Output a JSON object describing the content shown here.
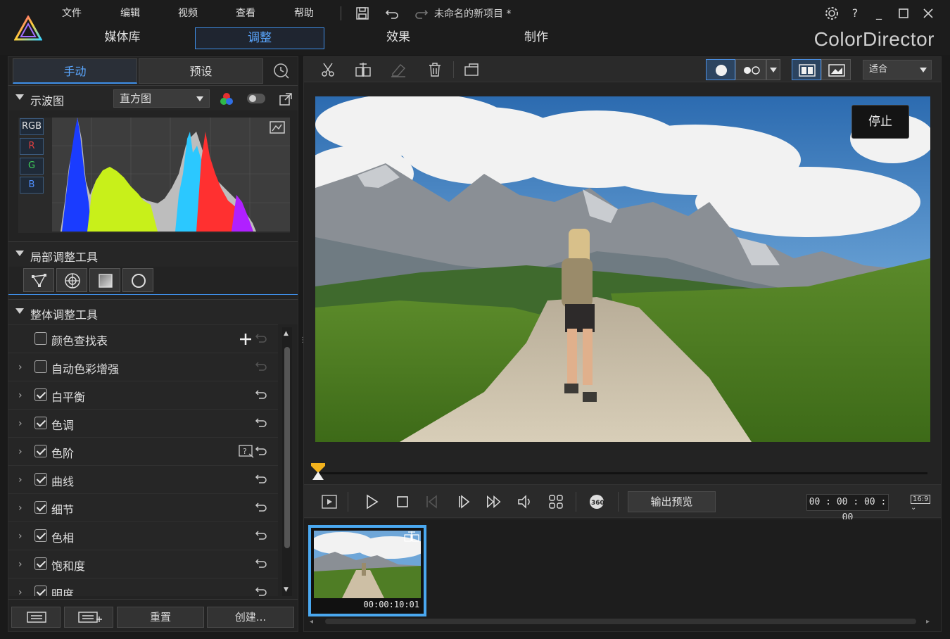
{
  "app": {
    "name": "ColorDirector",
    "project_title": "未命名的新项目 *"
  },
  "menu": [
    "文件",
    "编辑",
    "视频",
    "查看",
    "帮助"
  ],
  "main_tabs": [
    "媒体库",
    "调整",
    "效果",
    "制作"
  ],
  "active_main_tab": "调整",
  "left_panel": {
    "sub_tabs": [
      "手动",
      "预设"
    ],
    "active_sub_tab": "手动",
    "waveform_section": {
      "title": "示波图",
      "mode": "直方图",
      "channels": [
        "RGB",
        "R",
        "G",
        "B"
      ]
    },
    "local_tools": {
      "title": "局部调整工具",
      "tools": [
        "path-tool-icon",
        "radial-tool-icon",
        "gradient-tool-icon",
        "brush-tool-icon"
      ]
    },
    "global_tools": {
      "title": "整体调整工具",
      "items": [
        {
          "label": "颜色查找表",
          "checked": false,
          "expandable": false
        },
        {
          "label": "自动色彩增强",
          "checked": false,
          "expandable": true
        },
        {
          "label": "白平衡",
          "checked": true,
          "expandable": true
        },
        {
          "label": "色调",
          "checked": true,
          "expandable": true
        },
        {
          "label": "色阶",
          "checked": true,
          "expandable": true
        },
        {
          "label": "曲线",
          "checked": true,
          "expandable": true
        },
        {
          "label": "细节",
          "checked": true,
          "expandable": true
        },
        {
          "label": "色相",
          "checked": true,
          "expandable": true
        },
        {
          "label": "饱和度",
          "checked": true,
          "expandable": true
        },
        {
          "label": "明度",
          "checked": true,
          "expandable": true
        }
      ]
    },
    "bottom_buttons": {
      "reset": "重置",
      "create": "创建..."
    }
  },
  "preview": {
    "fit_option": "适合",
    "stop_label": "停止",
    "output_preview_label": "输出预览",
    "timecode": "00 : 00 : 00 : 00",
    "aspect_ratio": "16:9"
  },
  "clips": [
    {
      "duration": "00:00:10:01"
    }
  ]
}
